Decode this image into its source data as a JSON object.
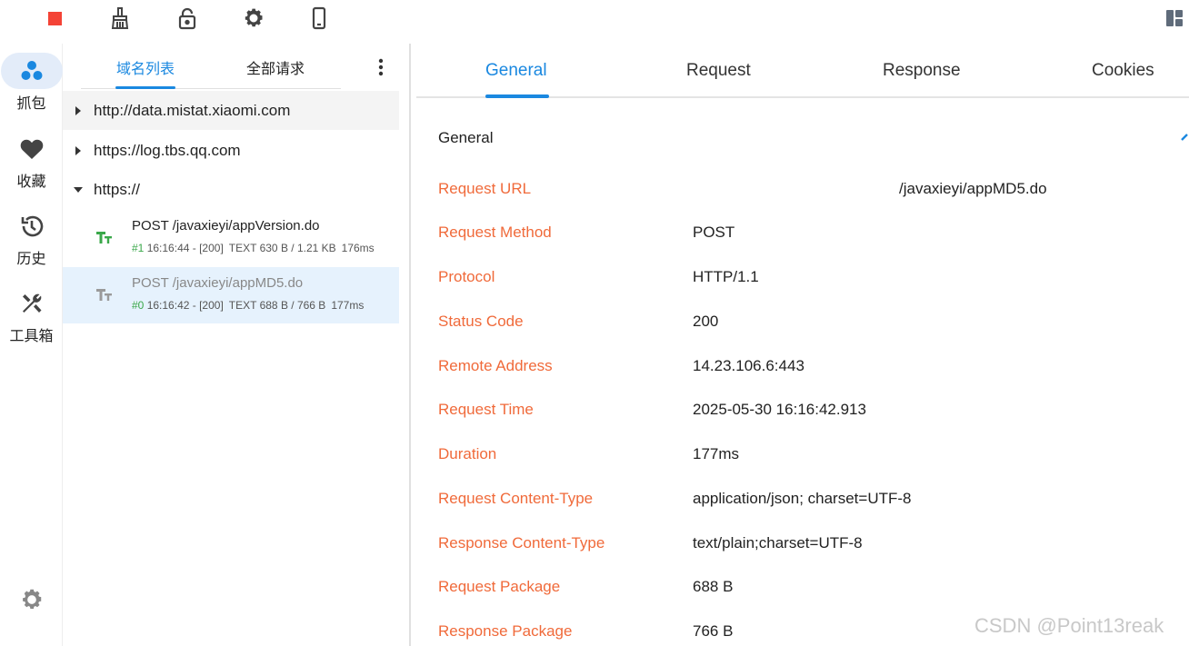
{
  "toolbar": {
    "buttons": [
      "stop-icon",
      "broom-icon",
      "lock-icon",
      "gear-icon",
      "phone-icon"
    ],
    "layout_icon": "layout-icon",
    "accent_stop": "#f44336"
  },
  "nav": {
    "items": [
      {
        "label": "抓包",
        "icon": "capture-icon"
      },
      {
        "label": "收藏",
        "icon": "heart-icon"
      },
      {
        "label": "历史",
        "icon": "history-icon"
      },
      {
        "label": "工具箱",
        "icon": "tools-icon"
      }
    ],
    "settings_icon": "gear-icon"
  },
  "list": {
    "tabs": [
      "域名列表",
      "全部请求"
    ],
    "domains": [
      "http://data.mistat.xiaomi.com",
      "https://log.tbs.qq.com",
      "https://"
    ],
    "requests": [
      {
        "path": "POST /javaxieyi/appVersion.do",
        "num": "#1",
        "time": "16:16:44",
        "status": "- [200]",
        "size": "TEXT 630 B / 1.21 KB",
        "duration": "176ms"
      },
      {
        "path": "POST /javaxieyi/appMD5.do",
        "num": "#0",
        "time": "16:16:42",
        "status": "- [200]",
        "size": "TEXT 688 B / 766 B",
        "duration": "177ms"
      }
    ]
  },
  "detail": {
    "tabs": [
      "General",
      "Request",
      "Response",
      "Cookies"
    ],
    "section_title": "General",
    "fields": [
      {
        "key": "Request URL",
        "value": "/javaxieyi/appMD5.do"
      },
      {
        "key": "Request Method",
        "value": "POST"
      },
      {
        "key": "Protocol",
        "value": "HTTP/1.1"
      },
      {
        "key": "Status Code",
        "value": "200"
      },
      {
        "key": "Remote Address",
        "value": "14.23.106.6:443"
      },
      {
        "key": "Request Time",
        "value": "2025-05-30 16:16:42.913"
      },
      {
        "key": "Duration",
        "value": "177ms"
      },
      {
        "key": "Request Content-Type",
        "value": "application/json; charset=UTF-8"
      },
      {
        "key": "Response Content-Type",
        "value": "text/plain;charset=UTF-8"
      },
      {
        "key": "Request Package",
        "value": "688 B"
      },
      {
        "key": "Response Package",
        "value": "766 B"
      }
    ],
    "key_color": "#f06a3a",
    "accent": "#1a88e0"
  },
  "watermark": "CSDN @Point13reak"
}
